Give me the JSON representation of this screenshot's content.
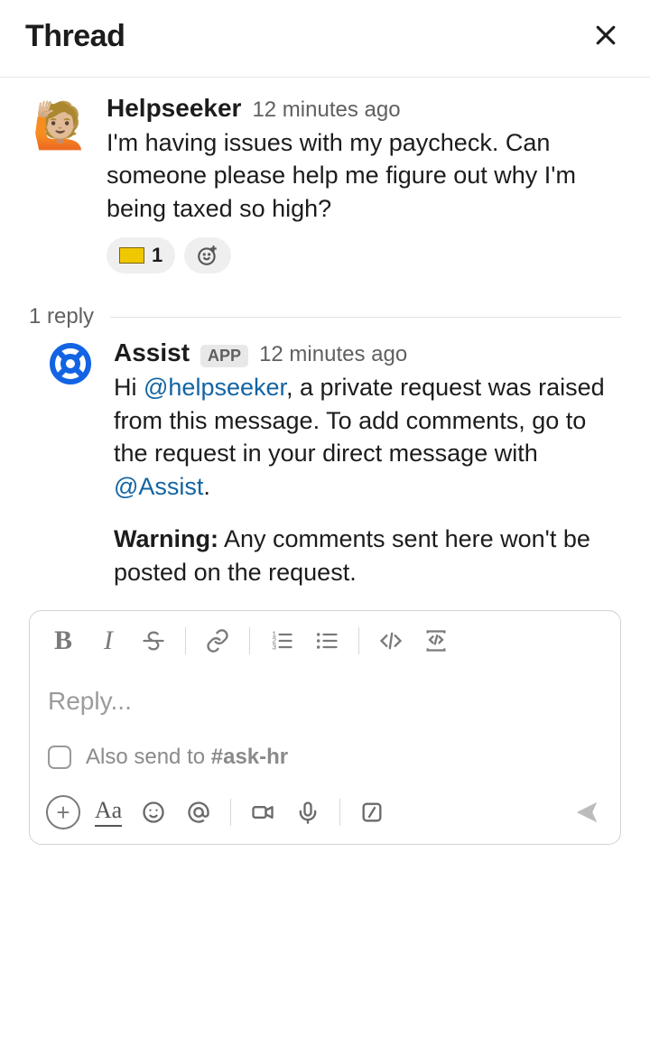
{
  "header": {
    "title": "Thread"
  },
  "message1": {
    "author": "Helpseeker",
    "timestamp": "12 minutes ago",
    "text": "I'm having issues with my paycheck. Can someone please help me figure out why I'm being taxed so high?",
    "reaction_count": "1"
  },
  "divider": {
    "label": "1 reply"
  },
  "message2": {
    "author": "Assist",
    "app_badge": "APP",
    "timestamp": "12 minutes ago",
    "p1_pre": "Hi ",
    "p1_mention1": "@helpseeker",
    "p1_mid": ",  a private request was raised from this message. To add comments, go to the request in your direct message with ",
    "p1_mention2": "@Assist",
    "p1_post": ".",
    "p2_bold": "Warning:",
    "p2_rest": " Any comments sent here won't be posted on the request."
  },
  "composer": {
    "placeholder": "Reply...",
    "also_send_pre": "Also send to ",
    "also_send_channel": "#ask-hr"
  }
}
